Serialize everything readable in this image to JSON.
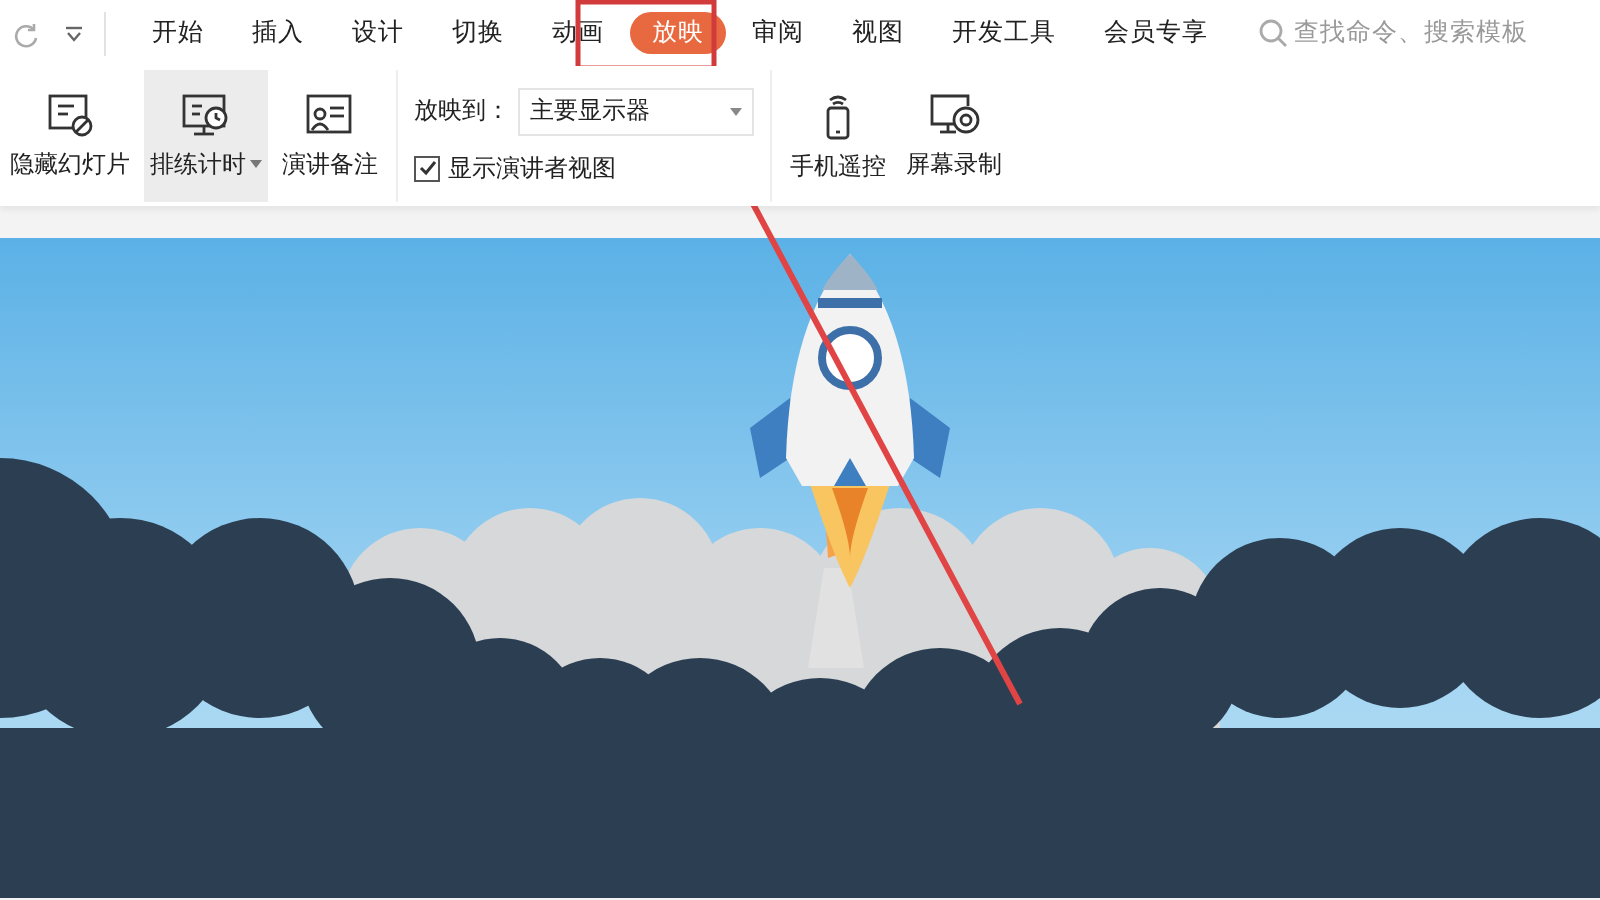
{
  "tabs": [
    {
      "label": "开始",
      "selected": false
    },
    {
      "label": "插入",
      "selected": false
    },
    {
      "label": "设计",
      "selected": false
    },
    {
      "label": "切换",
      "selected": false
    },
    {
      "label": "动画",
      "selected": false
    },
    {
      "label": "放映",
      "selected": true
    },
    {
      "label": "审阅",
      "selected": false
    },
    {
      "label": "视图",
      "selected": false
    },
    {
      "label": "开发工具",
      "selected": false
    },
    {
      "label": "会员专享",
      "selected": false
    }
  ],
  "search": {
    "placeholder": "查找命令、搜索模板"
  },
  "ribbon": [
    {
      "kind": "button",
      "label": "隐藏幻灯片",
      "selected": false,
      "dropdown": false
    },
    {
      "kind": "button",
      "label": "排练计时",
      "selected": true,
      "dropdown": true
    },
    {
      "kind": "button",
      "label": "演讲备注",
      "selected": false,
      "dropdown": false
    },
    {
      "kind": "group",
      "target_label": "放映到：",
      "target_value": "主要显示器",
      "checkbox": {
        "label": "显示演讲者视图",
        "checked": true
      }
    },
    {
      "kind": "button",
      "label": "手机遥控",
      "selected": false,
      "dropdown": false
    },
    {
      "kind": "button",
      "label": "屏幕录制",
      "selected": false,
      "dropdown": false
    }
  ]
}
